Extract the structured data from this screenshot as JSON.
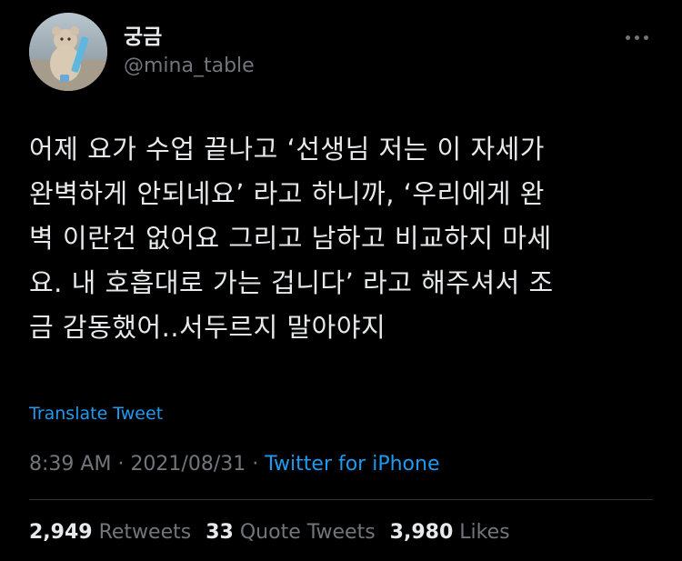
{
  "user": {
    "display_name": "궁금",
    "handle": "@mina_table"
  },
  "tweet": {
    "lines": [
      "어제 요가 수업 끝나고 ‘선생님 저는 이 자세가",
      "완벽하게 안되네요’ 라고 하니까, ‘우리에게 완",
      "벽 이란건 없어요 그리고 남하고 비교하지 마세",
      "요. 내 호흡대로 가는 겁니다’ 라고 해주셔서 조",
      "금 감동했어..서두르지 말아야지"
    ],
    "translate_label": "Translate Tweet",
    "time": "8:39 AM",
    "date": "2021/08/31",
    "separator": "·",
    "source": "Twitter for iPhone"
  },
  "stats": {
    "retweets_count": "2,949",
    "retweets_label": "Retweets",
    "quotes_count": "33",
    "quotes_label": "Quote Tweets",
    "likes_count": "3,980",
    "likes_label": "Likes"
  },
  "icons": {
    "more": "more-horizontal-icon"
  },
  "colors": {
    "background": "#000000",
    "text": "#e7e9ea",
    "secondary": "#71767b",
    "accent": "#1d9bf0",
    "divider": "#2f3336"
  }
}
